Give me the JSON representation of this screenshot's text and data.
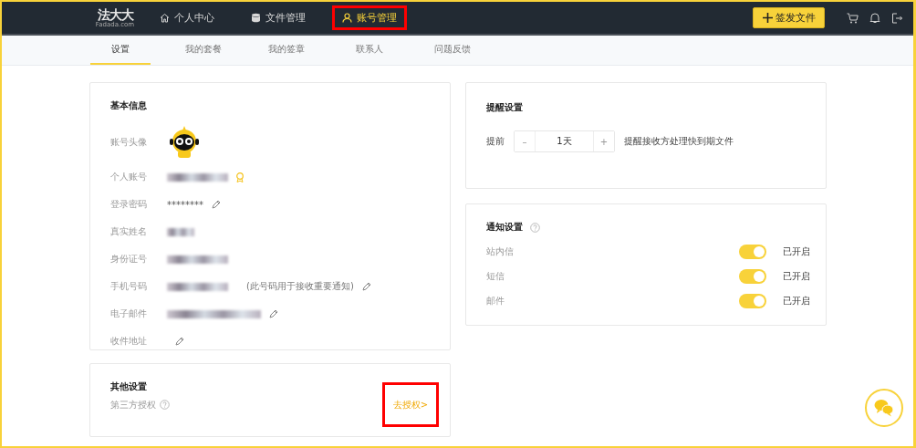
{
  "header": {
    "logo": "法大大",
    "logo_sub": "Fadada.com",
    "nav": [
      {
        "label": "个人中心",
        "selected": false,
        "highlighted": false
      },
      {
        "label": "文件管理",
        "selected": false,
        "highlighted": false
      },
      {
        "label": "账号管理",
        "selected": true,
        "highlighted": true
      }
    ],
    "action_button": "签发文件"
  },
  "tabs": [
    {
      "label": "设置",
      "selected": true
    },
    {
      "label": "我的套餐",
      "selected": false
    },
    {
      "label": "我的签章",
      "selected": false
    },
    {
      "label": "联系人",
      "selected": false
    },
    {
      "label": "问题反馈",
      "selected": false
    }
  ],
  "basic_info": {
    "title": "基本信息",
    "rows": [
      {
        "label": "账号头像",
        "kind": "avatar"
      },
      {
        "label": "个人账号",
        "kind": "redacted",
        "badge": true,
        "editable": false
      },
      {
        "label": "登录密码",
        "kind": "text",
        "value": "********",
        "editable": true
      },
      {
        "label": "真实姓名",
        "kind": "redacted",
        "editable": false
      },
      {
        "label": "身份证号",
        "kind": "redacted",
        "editable": false
      },
      {
        "label": "手机号码",
        "kind": "redacted",
        "note": "(此号码用于接收重要通知)",
        "editable": true
      },
      {
        "label": "电子邮件",
        "kind": "redacted",
        "editable": true
      },
      {
        "label": "收件地址",
        "kind": "empty",
        "editable": true
      }
    ]
  },
  "reminder": {
    "title": "提醒设置",
    "prefix": "提前",
    "minus": "–",
    "value": "1天",
    "plus": "+",
    "description": "提醒接收方处理快到期文件"
  },
  "notifications": {
    "title": "通知设置",
    "items": [
      {
        "label": "站内信",
        "on": true,
        "status": "已开启"
      },
      {
        "label": "短信",
        "on": true,
        "status": "已开启"
      },
      {
        "label": "邮件",
        "on": true,
        "status": "已开启"
      }
    ]
  },
  "other": {
    "title": "其他设置",
    "label": "第三方授权",
    "link": "去授权>",
    "highlighted": true
  }
}
